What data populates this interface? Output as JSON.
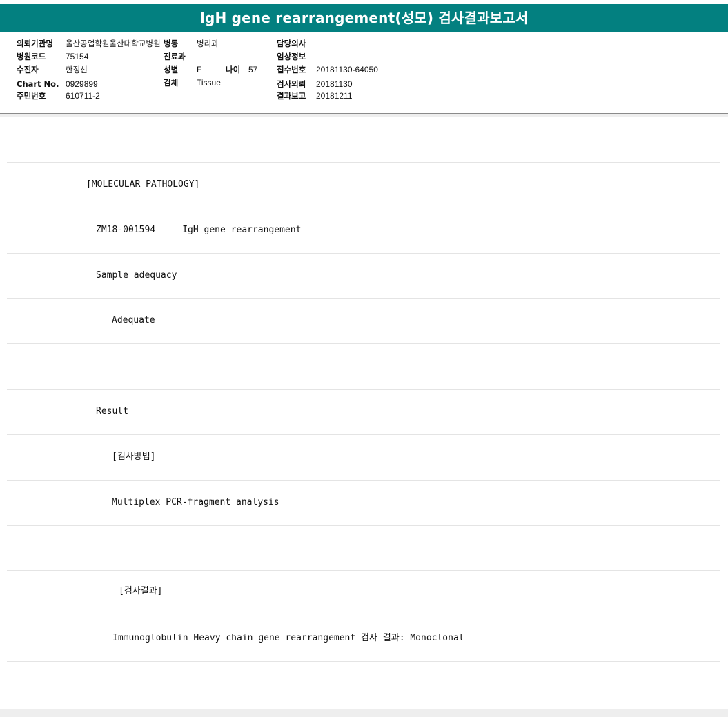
{
  "report": {
    "title": "IgH gene rearrangement(성모) 검사결과보고서"
  },
  "header": {
    "hospital_label": "의뢰기관명",
    "hospital_value": "울산공업학원울산대학교병원",
    "ward_label": "병동",
    "ward_value": "병리과",
    "doctor_label": "담당의사",
    "doctor_value": "",
    "hospital_code_label": "병원코드",
    "hospital_code_value": "75154",
    "department_label": "진료과",
    "department_value": "",
    "clinical_info_label": "임상정보",
    "clinical_info_value": "",
    "patient_label": "수진자",
    "patient_value": "한정선",
    "sex_label": "성별",
    "sex_value": "F",
    "age_label": "나이",
    "age_value": "57",
    "receipt_no_label": "접수번호",
    "receipt_no_value": "20181130-64050",
    "chart_no_label": "Chart No.",
    "chart_no_value": "0929899",
    "specimen_label": "검체",
    "specimen_value": "Tissue",
    "request_date_label": "검사의뢰",
    "request_date_value": "20181130",
    "resident_no_label": "주민번호",
    "resident_no_value": "610711-2",
    "report_date_label": "결과보고",
    "report_date_value": "20181211"
  },
  "body": {
    "lines": [
      "",
      "[MOLECULAR PATHOLOGY]",
      "ZM18-001594     IgH gene rearrangement",
      "Sample adequacy",
      "Adequate",
      "",
      "Result",
      "[검사방법]",
      "Multiplex PCR-fragment analysis",
      "",
      "[검사결과]",
      "Immunoglobulin Heavy chain gene rearrangement 검사 결과: Monoclonal",
      "",
      ""
    ]
  }
}
